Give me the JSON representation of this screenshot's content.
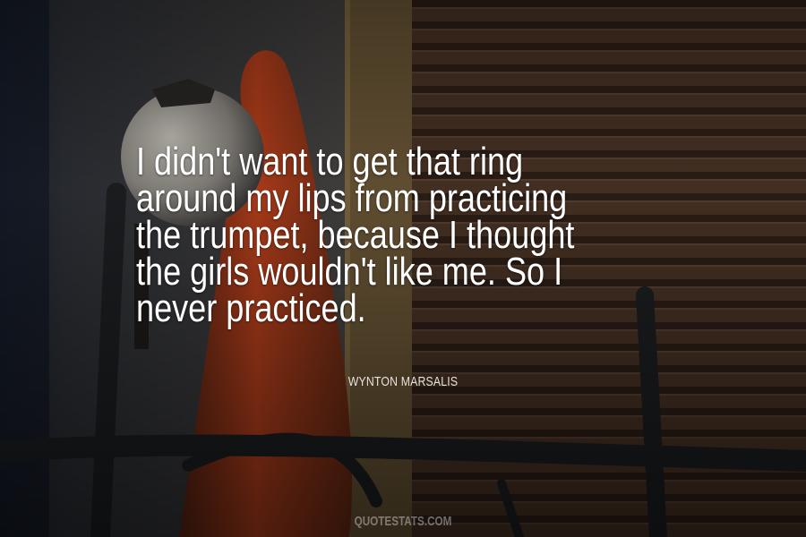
{
  "quote": {
    "lines": [
      "I didn't want to get that ring",
      "around my lips from practicing",
      "the trumpet, because I thought",
      "the girls wouldn't like me. So I",
      "never practiced."
    ]
  },
  "author": "WYNTON MARSALIS",
  "watermark": "QUOTESTATS.COM",
  "colors": {
    "quote_text": "#ffffff",
    "author_text": "#e8e2dc",
    "background_dark": "#2a211c",
    "shutter": "#4a3426",
    "cloth_accent": "#b8401c"
  }
}
